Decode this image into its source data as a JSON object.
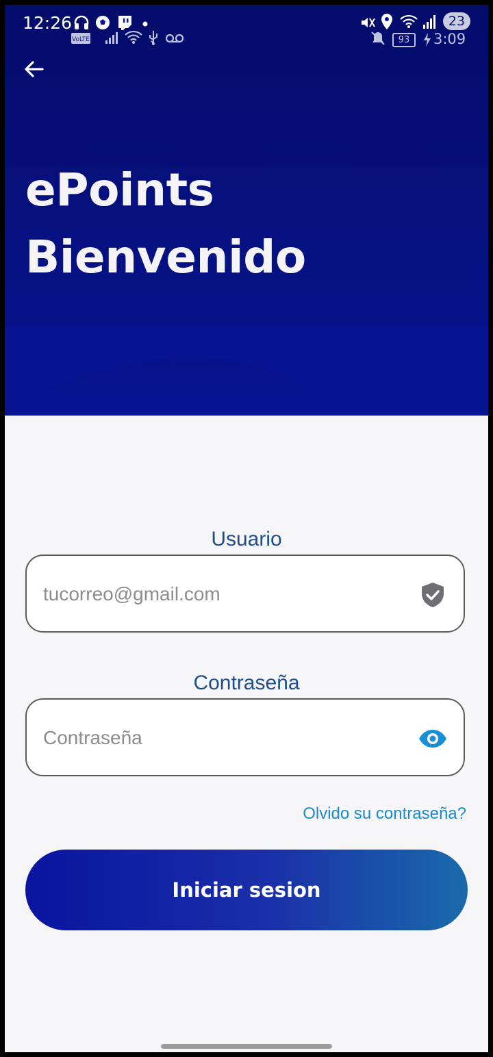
{
  "status_bar": {
    "time": "12:26",
    "badge": "23",
    "battery": "93",
    "secondary_time": "3:09"
  },
  "header": {
    "app_name": "ePoints",
    "welcome": "Bienvenido"
  },
  "form": {
    "user_label": "Usuario",
    "user_placeholder": "tucorreo@gmail.com",
    "password_label": "Contraseña",
    "password_placeholder": "Contraseña",
    "forgot_link": "Olvido su contraseña?",
    "submit_label": "Iniciar sesion"
  },
  "colors": {
    "primary": "#081491",
    "accent_link": "#1a8ac9",
    "label": "#1d4e8b"
  },
  "icons": [
    "back-arrow-icon",
    "shield-check-icon",
    "eye-icon"
  ]
}
